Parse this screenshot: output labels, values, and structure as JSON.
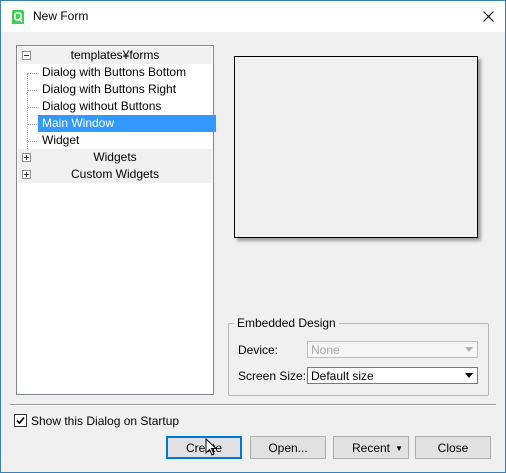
{
  "window": {
    "title": "New Form",
    "accent_color": "#3399ff"
  },
  "tree": {
    "root_category": "templates¥forms",
    "templates": [
      {
        "label": "Dialog with Buttons Bottom",
        "selected": false
      },
      {
        "label": "Dialog with Buttons Right",
        "selected": false
      },
      {
        "label": "Dialog without Buttons",
        "selected": false
      },
      {
        "label": "Main Window",
        "selected": true
      },
      {
        "label": "Widget",
        "selected": false
      }
    ],
    "other_categories": [
      "Widgets",
      "Custom Widgets"
    ]
  },
  "embedded_design": {
    "title": "Embedded Design",
    "device_label": "Device:",
    "device_value": "None",
    "screen_size_label": "Screen Size:",
    "screen_size_value": "Default size"
  },
  "startup": {
    "label": "Show this Dialog on Startup",
    "checked": true
  },
  "buttons": {
    "create": "Create",
    "open": "Open...",
    "recent": "Recent",
    "close": "Close"
  }
}
